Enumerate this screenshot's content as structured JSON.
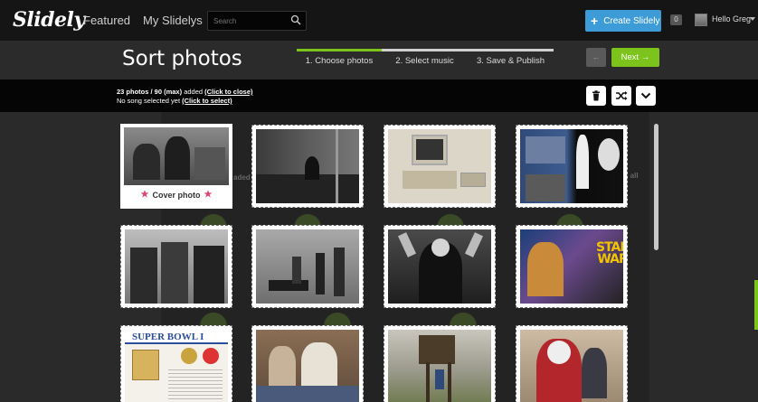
{
  "nav": {
    "logo": "Slidely",
    "featured": "Featured",
    "my_slidelys": "My Slidelys",
    "search_placeholder": "Search",
    "create_button": "Create Slidely",
    "notifications": "0",
    "greeting": "Hello Greg"
  },
  "header": {
    "title": "Sort photos",
    "steps": [
      "1. Choose photos",
      "2. Select music",
      "3. Save & Publish"
    ],
    "back_label": "←",
    "next_label": "Next →"
  },
  "info": {
    "photos_count": "23 photos / 90 (max)",
    "added": " added ",
    "close_link": "(Click to close)",
    "song_status": "No song selected yet ",
    "select_link": "(Click to select)"
  },
  "background": {
    "added_text": "aded",
    "see_all_text": "e all"
  },
  "tiles": {
    "cover_label": "Cover photo",
    "super_bowl": "SUPER BOWL I",
    "star_wars_top": "STAR",
    "star_wars_bottom": "WAR"
  },
  "colors": {
    "accent_green": "#7cc31c",
    "create_blue": "#3d9bd8",
    "cover_star": "#e0436d"
  }
}
